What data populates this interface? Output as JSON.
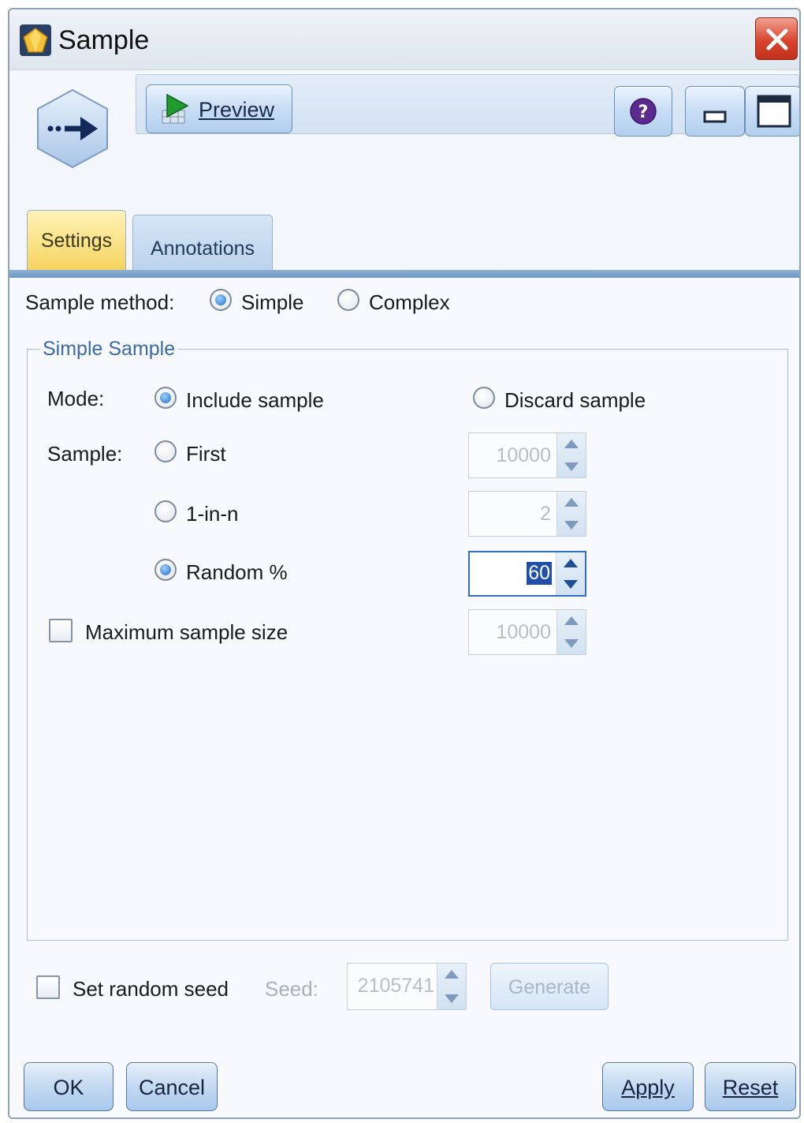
{
  "window": {
    "title": "Sample"
  },
  "toolbar": {
    "preview_label": "Preview"
  },
  "tabs": [
    {
      "label": "Settings",
      "selected": true
    },
    {
      "label": "Annotations",
      "selected": false
    }
  ],
  "sample_method": {
    "label": "Sample method:",
    "options": [
      {
        "label": "Simple",
        "selected": true
      },
      {
        "label": "Complex",
        "selected": false
      }
    ]
  },
  "simple_sample": {
    "group_title": "Simple Sample",
    "mode": {
      "label": "Mode:",
      "include_label": "Include sample",
      "discard_label": "Discard sample",
      "selected": "include"
    },
    "sample": {
      "label": "Sample:",
      "first_label": "First",
      "first_value": "10000",
      "one_in_n_label": "1-in-n",
      "one_in_n_value": "2",
      "random_label": "Random %",
      "random_value": "60",
      "selected": "random"
    },
    "max_size": {
      "label": "Maximum sample size",
      "checked": false,
      "value": "10000"
    }
  },
  "seed": {
    "checkbox_label": "Set random seed",
    "checked": false,
    "seed_label": "Seed:",
    "seed_value": "2105741",
    "generate_label": "Generate"
  },
  "footer": {
    "ok_label": "OK",
    "cancel_label": "Cancel",
    "apply_label": "Apply",
    "reset_label": "Reset"
  },
  "colors": {
    "accent_blue": "#1f6fc8",
    "tab_selected": "#f6d25a",
    "close_red": "#d8462e"
  }
}
